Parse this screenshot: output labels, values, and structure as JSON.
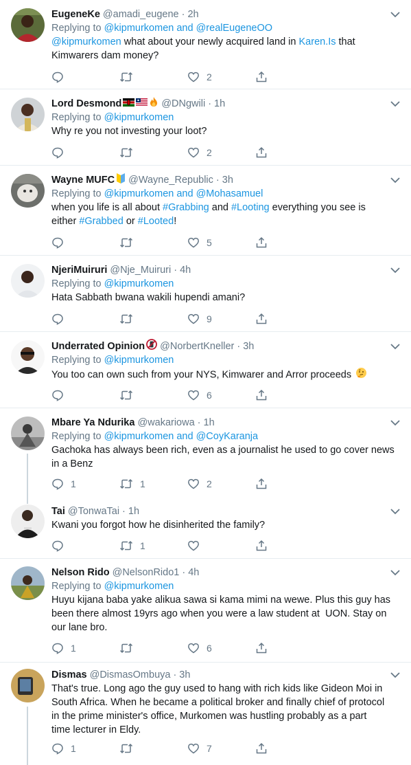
{
  "tweets": [
    {
      "name": "EugeneKe",
      "handle": "@amadi_eugene",
      "time": "2h",
      "replying_prefix": "Replying to ",
      "replying_to": "@kipmurkomen and @realEugeneOO",
      "text_parts": [
        "@kipmurkomen",
        " what about your newly acquired land in ",
        "Karen.Is",
        " that"
      ],
      "text_line2": "Kimwarers dam money?",
      "reply_count": "",
      "retweet_count": "",
      "like_count": "2"
    },
    {
      "name": "Lord Desmond",
      "handle": "@DNgwili",
      "time": "1h",
      "replying_prefix": "Replying to ",
      "replying_to": "@kipmurkomen",
      "text": "Why re you not investing your loot?",
      "reply_count": "",
      "retweet_count": "",
      "like_count": "2"
    },
    {
      "name": "Wayne MUFC",
      "handle": "@Wayne_Republic",
      "time": "3h",
      "replying_prefix": "Replying to ",
      "replying_to": "@kipmurkomen and @Mohasamuel",
      "line1_parts": [
        "when you life is all about ",
        "#Grabbing",
        " and ",
        "#Looting",
        " everything you see is"
      ],
      "line2_parts": [
        "either ",
        "#Grabbed",
        " or ",
        "#Looted",
        "!"
      ],
      "reply_count": "",
      "retweet_count": "",
      "like_count": "5"
    },
    {
      "name": "NjeriMuiruri",
      "handle": "@Nje_Muiruri",
      "time": "4h",
      "replying_prefix": "Replying to ",
      "replying_to": "@kipmurkomen",
      "text": "Hata Sabbath bwana wakili hupendi amani?",
      "reply_count": "",
      "retweet_count": "",
      "like_count": "9"
    },
    {
      "name": "Underrated Opinion",
      "handle": "@NorbertKneller",
      "time": "3h",
      "replying_prefix": "Replying to ",
      "replying_to": "@kipmurkomen",
      "text": "You too can own such from your NYS, Kimwarer and Arror proceeds",
      "reply_count": "",
      "retweet_count": "",
      "like_count": "6"
    },
    {
      "name": "Mbare Ya Ndurika",
      "handle": "@wakariowa",
      "time": "1h",
      "replying_prefix": "Replying to ",
      "replying_to": "@kipmurkomen and @CoyKaranja",
      "text_line1": "Gachoka has always been rich, even as a journalist he used to go cover news",
      "text_line2": "in a Benz",
      "reply_count": "1",
      "retweet_count": "1",
      "like_count": "2"
    },
    {
      "name": "Tai",
      "handle": "@TonwaTai",
      "time": "1h",
      "text": "Kwani you forgot how he disinherited the family?",
      "reply_count": "",
      "retweet_count": "1",
      "like_count": ""
    },
    {
      "name": "Nelson Rido",
      "handle": "@NelsonRido1",
      "time": "4h",
      "replying_prefix": "Replying to ",
      "replying_to": "@kipmurkomen",
      "text_line1": "Huyu kijana baba yake alikua sawa si kama mimi na wewe. Plus this guy has",
      "text_line2": "been there almost 19yrs ago when you were a law student at  UON. Stay on",
      "text_line3": "our lane bro.",
      "reply_count": "1",
      "retweet_count": "",
      "like_count": "6"
    },
    {
      "name": "Dismas",
      "handle": "@DismasOmbuya",
      "time": "3h",
      "text_line1": "That's true. Long ago the guy used to hang with rich kids like Gideon Moi in",
      "text_line2": "South Africa. When he became a political broker and finally chief of protocol",
      "text_line3": "in the prime minister's office, Murkomen was hustling probably as a part",
      "text_line4": "time lecturer in Eldy.",
      "reply_count": "1",
      "retweet_count": "",
      "like_count": "7"
    }
  ],
  "dot": "·",
  "icons": {
    "reply": "reply-icon",
    "retweet": "retweet-icon",
    "like": "heart-icon",
    "share": "share-icon",
    "caret": "chevron-down-icon"
  },
  "colors": {
    "link": "#1b95e0",
    "muted": "#657786",
    "text": "#14171a",
    "divider": "#e6ecf0",
    "thread": "#ccd6dd"
  }
}
